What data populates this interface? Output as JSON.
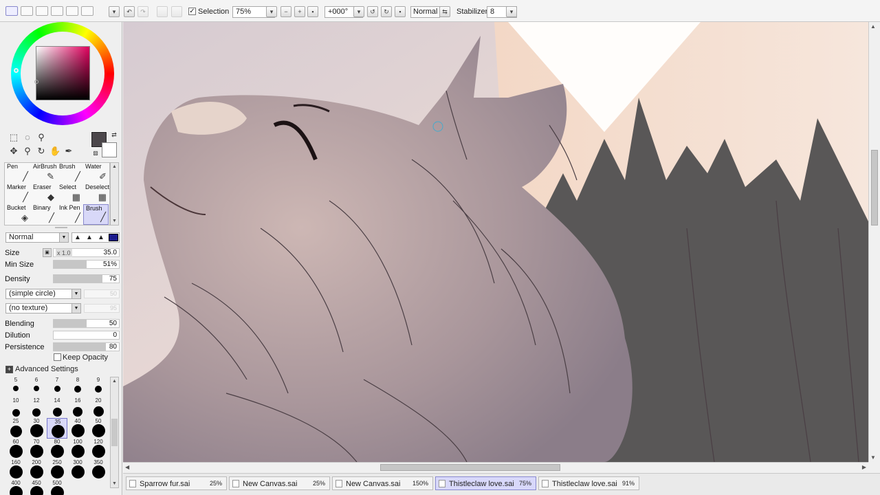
{
  "toolbar": {
    "selection_label": "Selection",
    "selection_checked": "✓",
    "zoom": "75%",
    "rotation": "+000°",
    "blend_mode": "Normal",
    "stabilizer_label": "Stabilizer",
    "stabilizer_value": "8"
  },
  "color": {
    "foreground": "#4c474b",
    "background": "#ffffff",
    "hue_accent": "#e0005e"
  },
  "tools": [
    {
      "label": "Pen",
      "icon": "pen-icon",
      "glyph": "╱"
    },
    {
      "label": "AirBrush",
      "icon": "airbrush-icon",
      "glyph": "✎"
    },
    {
      "label": "Brush",
      "icon": "brush-icon",
      "glyph": "╱"
    },
    {
      "label": "Water",
      "icon": "water-brush-icon",
      "glyph": "✐"
    },
    {
      "label": "Marker",
      "icon": "marker-icon",
      "glyph": "╱"
    },
    {
      "label": "Eraser",
      "icon": "eraser-icon",
      "glyph": "◆"
    },
    {
      "label": "Select",
      "icon": "select-pen-icon",
      "glyph": "▦"
    },
    {
      "label": "Deselect",
      "icon": "deselect-icon",
      "glyph": "▦"
    },
    {
      "label": "Bucket",
      "icon": "bucket-icon",
      "glyph": "◈"
    },
    {
      "label": "Binary",
      "icon": "binary-pen-icon",
      "glyph": "╱"
    },
    {
      "label": "Ink Pen",
      "icon": "ink-pen-icon",
      "glyph": "╱"
    },
    {
      "label": "Brush",
      "icon": "brush-icon",
      "glyph": "╱"
    }
  ],
  "brush_settings": {
    "blend_mode": "Normal",
    "size_label": "Size",
    "size_multiplier": "x 1.0",
    "size_value": "35.0",
    "min_size_label": "Min Size",
    "min_size_value": "51%",
    "min_size_fraction": 0.51,
    "density_label": "Density",
    "density_value": "75",
    "density_fraction": 0.75,
    "shape": "(simple circle)",
    "shape_ghost": "50",
    "texture": "(no texture)",
    "texture_ghost": "95",
    "blending_label": "Blending",
    "blending_value": "50",
    "blending_fraction": 0.5,
    "dilution_label": "Dilution",
    "dilution_value": "0",
    "dilution_fraction": 0,
    "persistence_label": "Persistence",
    "persistence_value": "80",
    "persistence_fraction": 0.8,
    "keep_opacity_label": "Keep Opacity",
    "advanced_label": "Advanced Settings"
  },
  "brush_sizes": [
    "5",
    "6",
    "7",
    "8",
    "9",
    "10",
    "12",
    "14",
    "16",
    "20",
    "25",
    "30",
    "35",
    "40",
    "50",
    "60",
    "70",
    "80",
    "100",
    "120",
    "160",
    "200",
    "250",
    "300",
    "350",
    "400",
    "450",
    "500"
  ],
  "documents": [
    {
      "name": "Sparrow fur.sai",
      "zoom": "25%"
    },
    {
      "name": "New Canvas.sai",
      "zoom": "25%"
    },
    {
      "name": "New Canvas.sai",
      "zoom": "150%"
    },
    {
      "name": "Thistleclaw love.sai",
      "zoom": "75%"
    },
    {
      "name": "Thistleclaw love.sai",
      "zoom": "91%"
    }
  ]
}
